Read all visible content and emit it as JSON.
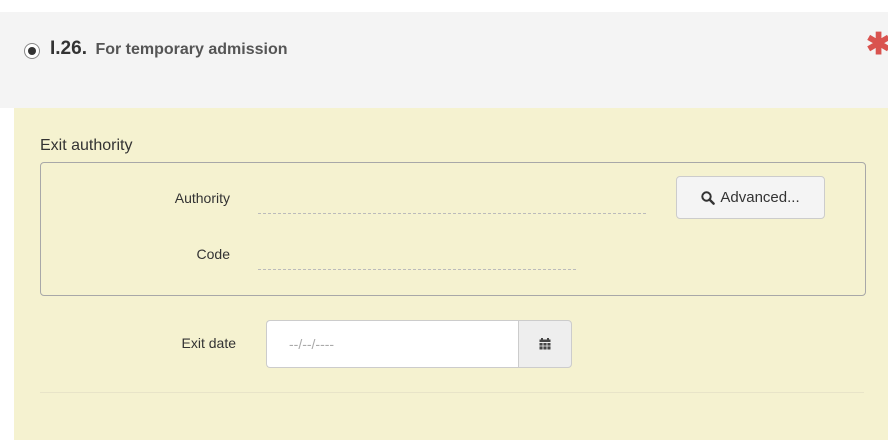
{
  "section": {
    "number": "I.26.",
    "title": "For temporary admission",
    "required_mark": "✱"
  },
  "exit_authority": {
    "legend": "Exit authority",
    "authority_label": "Authority",
    "authority_value": "",
    "code_label": "Code",
    "code_value": "",
    "advanced_button": "Advanced..."
  },
  "exit_date": {
    "label": "Exit date",
    "placeholder": "--/--/----",
    "value": ""
  },
  "icons": {
    "radio": "radio-selected-icon",
    "required": "asterisk-icon",
    "search": "search-icon",
    "calendar": "calendar-icon"
  },
  "colors": {
    "panel_bg": "#f5f2d0",
    "header_bg": "#f4f4f4",
    "required": "#d9534f"
  }
}
